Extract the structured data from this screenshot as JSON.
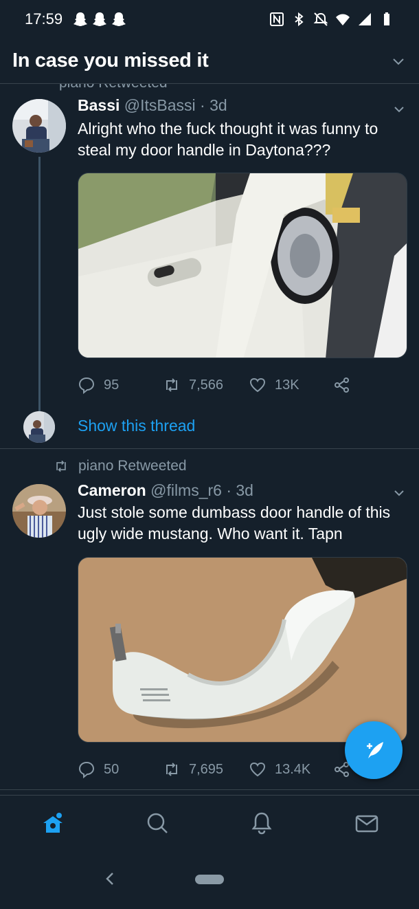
{
  "status_bar": {
    "time": "17:59",
    "notification_icons": [
      "snapchat-icon",
      "snapchat-icon",
      "snapchat-icon"
    ],
    "system_icons": [
      "nfc-icon",
      "bluetooth-icon",
      "mute-icon",
      "wifi-icon",
      "signal-icon",
      "battery-icon"
    ]
  },
  "header": {
    "title": "In case you missed it"
  },
  "cut_off_retweet": {
    "label": "piano Retweeted"
  },
  "tweets": [
    {
      "name": "Bassi",
      "handle": "@ItsBassi",
      "time": "· 3d",
      "text": "Alright who the fuck thought it was funny to steal my door handle in Daytona???",
      "image": "white-mustang-door-photo",
      "replies": "95",
      "retweets": "7,566",
      "likes": "13K",
      "show_thread": "Show this thread"
    },
    {
      "retweeted_by": "piano Retweeted",
      "name": "Cameron",
      "handle": "@films_r6",
      "time": "· 3d",
      "text": "Just stole some dumbass door handle of this ugly wide mustang. Who want it. Tapn",
      "image": "door-handle-on-cardboard-photo",
      "replies": "50",
      "retweets": "7,695",
      "likes": "13.4K"
    }
  ],
  "colors": {
    "background": "#15202b",
    "accent": "#1da1f2",
    "secondary_text": "#8899a6",
    "divider": "#38444d"
  },
  "bottom_nav": {
    "items": [
      "home-icon",
      "search-icon",
      "notifications-icon",
      "messages-icon"
    ],
    "active": "home-icon"
  }
}
